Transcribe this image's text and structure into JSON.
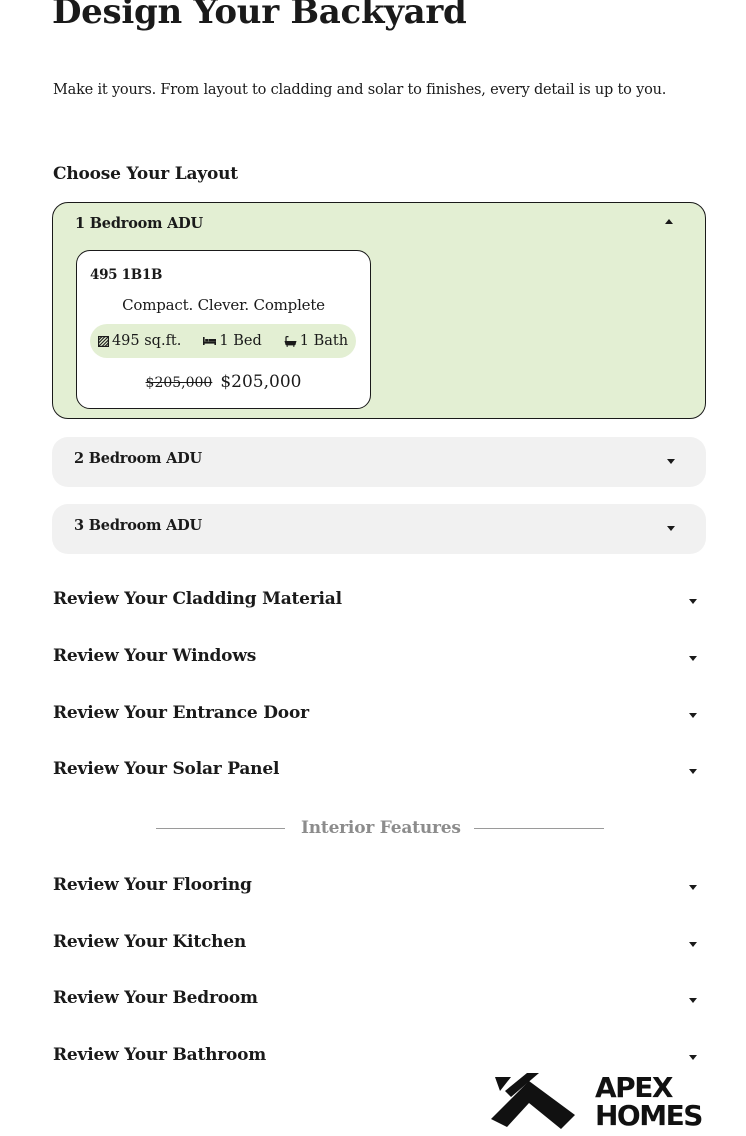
{
  "header": {
    "title": "Design Your Backyard",
    "subtitle": "Make it yours. From layout to cladding and solar to finishes, every detail is up to you."
  },
  "layout": {
    "heading": "Choose Your Layout",
    "options": [
      {
        "label": "1 Bedroom ADU",
        "expanded": true,
        "card": {
          "code": "495 1B1B",
          "tagline": "Compact. Clever. Complete",
          "area": "495 sq.ft.",
          "beds": "1 Bed",
          "baths": "1 Bath",
          "original_price": "$205,000",
          "price": "$205,000"
        }
      },
      {
        "label": "2 Bedroom ADU",
        "expanded": false
      },
      {
        "label": "3 Bedroom ADU",
        "expanded": false
      }
    ]
  },
  "exterior_sections": [
    {
      "label": "Review Your Cladding Material"
    },
    {
      "label": "Review Your Windows"
    },
    {
      "label": "Review Your Entrance Door"
    },
    {
      "label": "Review Your Solar Panel"
    }
  ],
  "interior_divider": "Interior Features",
  "interior_sections": [
    {
      "label": "Review Your Flooring"
    },
    {
      "label": "Review Your Kitchen"
    },
    {
      "label": "Review Your Bedroom"
    },
    {
      "label": "Review Your Bathroom"
    }
  ],
  "logo": {
    "line1": "APEX",
    "line2": "HOMES"
  },
  "icons": {
    "area": "floor-plan-icon",
    "beds": "bed-icon",
    "baths": "bathtub-icon",
    "expand": "chevron-down-icon",
    "collapse": "chevron-up-icon"
  },
  "colors": {
    "accent_green": "#e3efd3",
    "closed_panel": "#f1f1f1",
    "text": "#1a1a1a"
  }
}
